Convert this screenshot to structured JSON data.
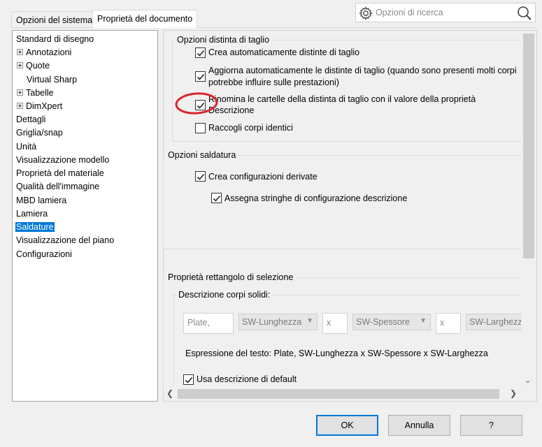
{
  "tabs": [
    {
      "label": "Opzioni del sistema",
      "active": false
    },
    {
      "label": "Proprietà del documento",
      "active": true
    }
  ],
  "search": {
    "placeholder": "Opzioni di ricerca",
    "icon": "gear-icon",
    "search_icon": "magnifier-icon"
  },
  "tree": {
    "items": [
      {
        "label": "Standard di disegno",
        "expandable": false
      },
      {
        "label": "Annotazioni",
        "expandable": true
      },
      {
        "label": "Quote",
        "expandable": true
      },
      {
        "label": "Virtual Sharp",
        "expandable": false
      },
      {
        "label": "Tabelle",
        "expandable": true
      },
      {
        "label": "DimXpert",
        "expandable": true
      },
      {
        "label": "Dettagli",
        "expandable": false
      },
      {
        "label": "Griglia/snap",
        "expandable": false
      },
      {
        "label": "Unità",
        "expandable": false
      },
      {
        "label": "Visualizzazione modello",
        "expandable": false
      },
      {
        "label": "Proprietà del materiale",
        "expandable": false
      },
      {
        "label": "Qualità dell'immagine",
        "expandable": false
      },
      {
        "label": "MBD lamiera",
        "expandable": false
      },
      {
        "label": "Lamiera",
        "expandable": false
      },
      {
        "label": "Saldature",
        "expandable": false,
        "selected": true
      },
      {
        "label": "Visualizzazione del piano",
        "expandable": false
      },
      {
        "label": "Configurazioni",
        "expandable": false
      }
    ]
  },
  "cut_list": {
    "title": "Opzioni distinta di taglio",
    "options": [
      {
        "label": "Crea automaticamente distinte di taglio",
        "checked": true
      },
      {
        "label_line1": "Aggiorna automaticamente le distinte di taglio (quando sono presenti molti corpi",
        "label_line2": "potrebbe influire sulle prestazioni)",
        "checked": true
      },
      {
        "label_line1": "Rinomina le cartelle della distinta di taglio con il valore della proprietà",
        "label_line2": "Descrizione",
        "checked": true
      },
      {
        "label": "Raccogli corpi identici",
        "checked": false
      }
    ]
  },
  "weldment": {
    "title": "Opzioni saldatura",
    "options": [
      {
        "label": "Crea configurazioni derivate",
        "checked": true
      },
      {
        "label": "Assegna stringhe di configurazione descrizione",
        "checked": true
      }
    ]
  },
  "bbox": {
    "title": "Proprietà rettangolo di selezione",
    "desc_title": "Descrizione corpi solidi:",
    "field1": "Plate,",
    "combo1": "SW-Lunghezza",
    "sep1": "x",
    "combo2": "SW-Spessore",
    "sep2": "x",
    "combo3": "SW-Larghezza",
    "expression": "Espressione del testo: Plate, SW-Lunghezza x SW-Spessore x SW-Larghezza",
    "default_desc": {
      "label": "Usa descrizione di default",
      "checked": true
    }
  },
  "buttons": {
    "ok": "OK",
    "cancel": "Annulla",
    "help": "?"
  },
  "colors": {
    "selection": "#0078d7",
    "annotation_circle": "#d9262e"
  }
}
